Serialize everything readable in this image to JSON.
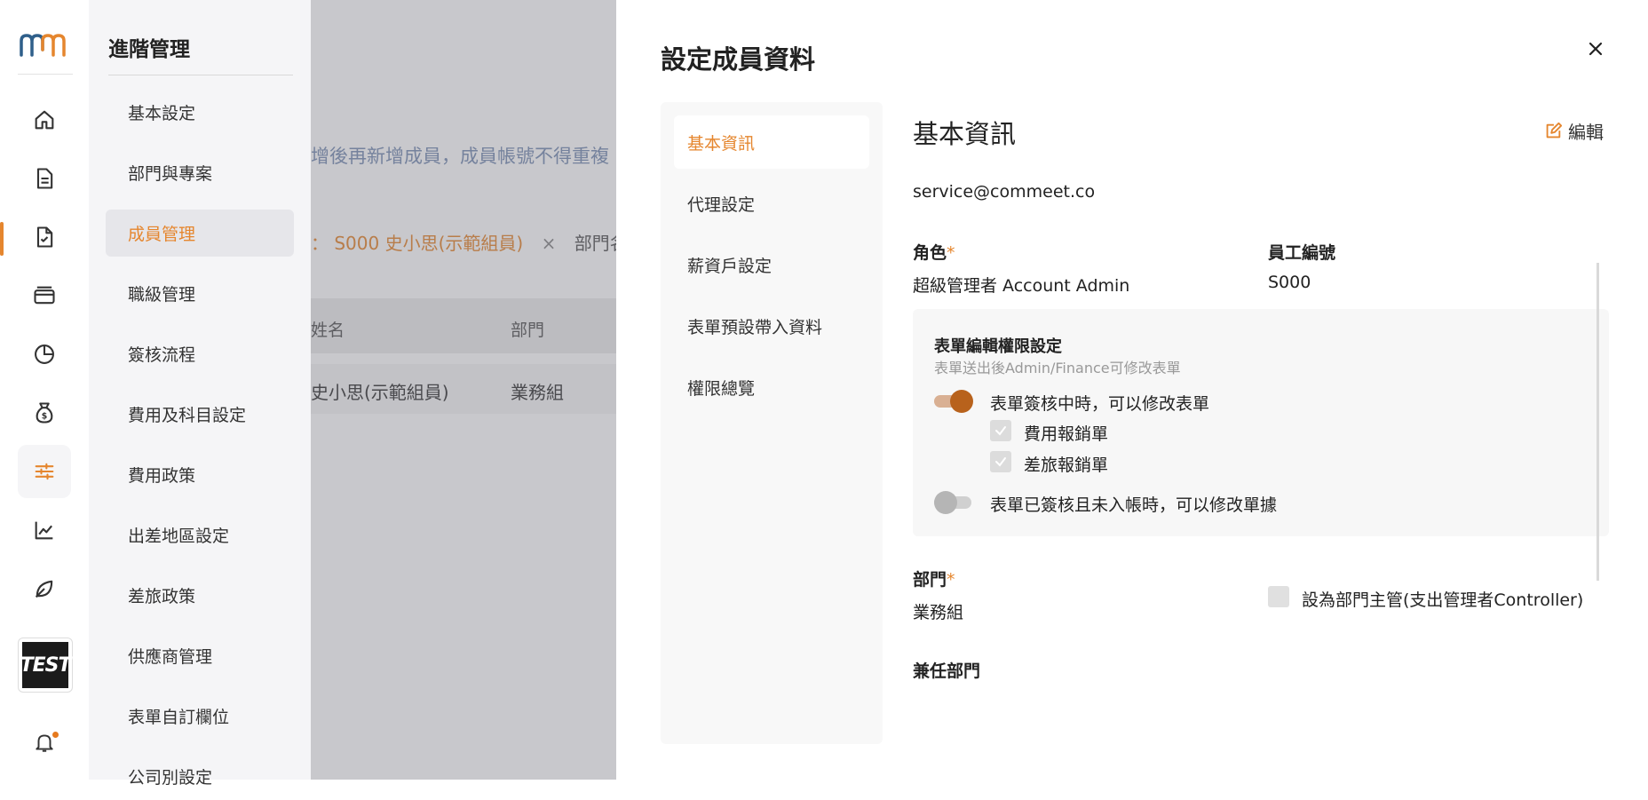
{
  "rail": {
    "icons": [
      "logo-icon",
      "home-icon",
      "document-icon",
      "document-check-icon",
      "card-icon",
      "pie-chart-icon",
      "money-bag-icon",
      "sliders-icon",
      "line-chart-icon",
      "leaf-icon",
      "bell-icon"
    ],
    "avatar_text": "TEST",
    "accent": "#e5862e"
  },
  "menu": {
    "title": "進階管理",
    "items": [
      "基本設定",
      "部門與專案",
      "成員管理",
      "職級管理",
      "簽核流程",
      "費用及科目設定",
      "費用政策",
      "出差地區設定",
      "差旅政策",
      "供應商管理",
      "表單自訂欄位",
      "公司別設定"
    ],
    "active_index": 2
  },
  "background": {
    "note": "增後再新增成員，成員帳號不得重複",
    "filter_prefix": "：",
    "filter_value": "S000 史小思(示範組員)",
    "filter_close": "×",
    "filter_next": "部門名稱",
    "columns": [
      "姓名",
      "部門"
    ],
    "row": [
      "史小思(示範組員)",
      "業務組"
    ]
  },
  "modal": {
    "title": "設定成員資料",
    "close_label": "×",
    "tabs": [
      "基本資訊",
      "代理設定",
      "薪資戶設定",
      "表單預設帶入資料",
      "權限總覽"
    ],
    "active_tab": 0,
    "section_title": "基本資訊",
    "edit_label": "編輯",
    "email": "service@commeet.co",
    "role_label": "角色",
    "role_required": "*",
    "role_value": "超級管理者 Account Admin",
    "employee_no_label": "員工編號",
    "employee_no_value": "S000",
    "permissions": {
      "title": "表單編輯權限設定",
      "subtitle": "表單送出後Admin/Finance可修改表單",
      "toggle1_label": "表單簽核中時，可以修改表單",
      "toggle1_on": true,
      "check1_label": "費用報銷單",
      "check2_label": "差旅報銷單",
      "toggle2_label": "表單已簽核且未入帳時，可以修改單據",
      "toggle2_on": false
    },
    "dept_label": "部門",
    "dept_required": "*",
    "dept_value": "業務組",
    "manager_checkbox_label": "設為部門主管(支出管理者Controller)",
    "concurrent_dept_label": "兼任部門"
  }
}
